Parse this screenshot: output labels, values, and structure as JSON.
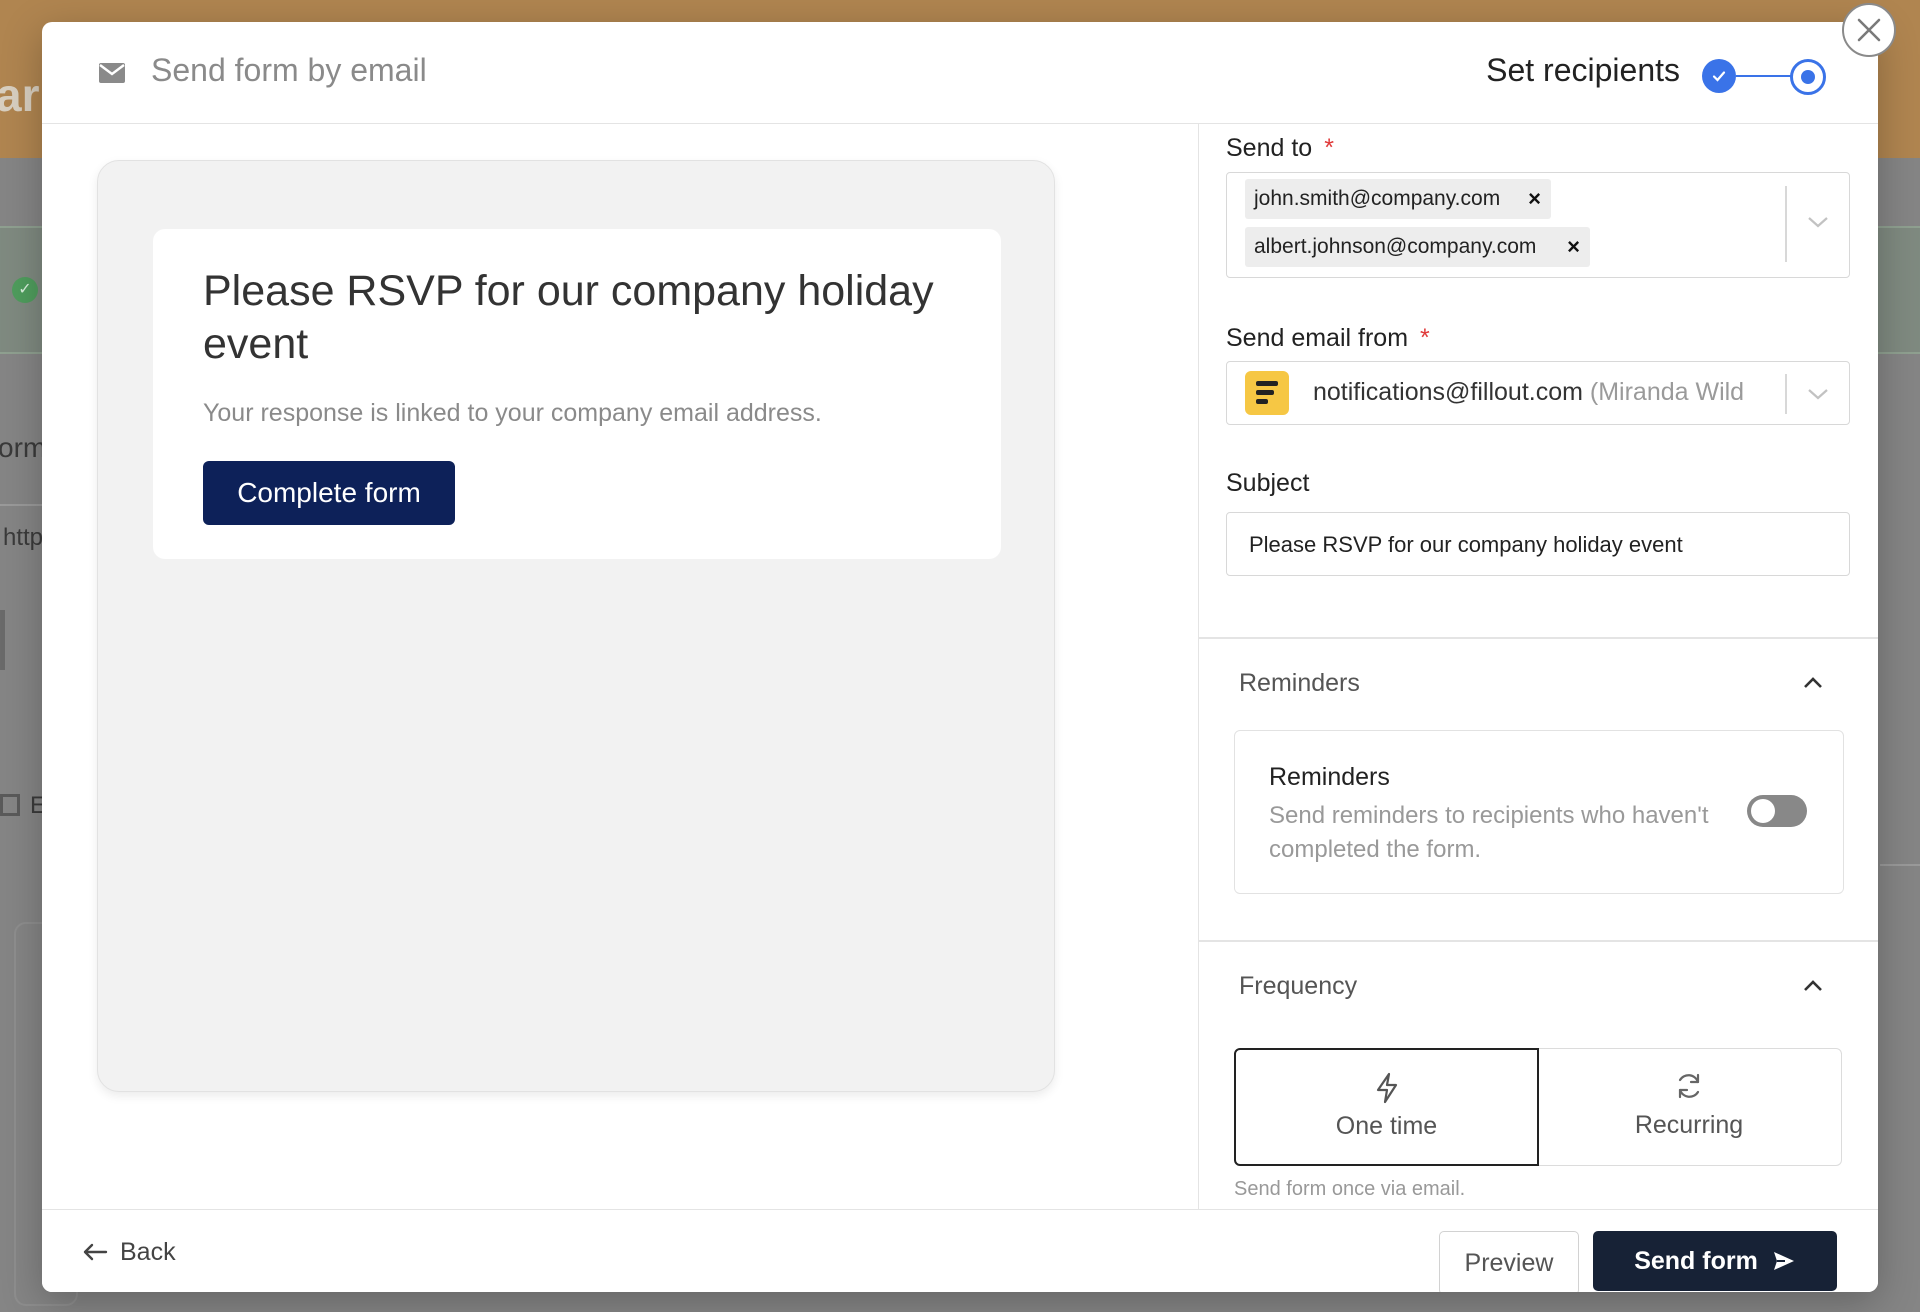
{
  "background": {
    "heading_fragment": "ar",
    "form_fragment": "orm",
    "link_fragment": "http",
    "embed_fragment": "E"
  },
  "header": {
    "title": "Send form by email",
    "step_label": "Set recipients"
  },
  "preview": {
    "title": "Please RSVP for our company holiday event",
    "text": "Your response is linked to your company email address.",
    "button_label": "Complete form"
  },
  "send_to": {
    "label": "Send to",
    "required_mark": "*",
    "chips": [
      {
        "email": "john.smith@company.com",
        "remove": "×"
      },
      {
        "email": "albert.johnson@company.com",
        "remove": "×"
      }
    ]
  },
  "send_from": {
    "label": "Send email from",
    "required_mark": "*",
    "email": "notifications@fillout.com",
    "name": "(Miranda Wild"
  },
  "subject": {
    "label": "Subject",
    "value": "Please RSVP for our company holiday event"
  },
  "reminders": {
    "section_title": "Reminders",
    "box_title": "Reminders",
    "description": "Send reminders to recipients who haven't completed the form.",
    "enabled": false
  },
  "frequency": {
    "section_title": "Frequency",
    "options": [
      {
        "label": "One time",
        "icon": "lightning-icon",
        "selected": true
      },
      {
        "label": "Recurring",
        "icon": "refresh-icon",
        "selected": false
      }
    ],
    "note": "Send form once via email."
  },
  "footer": {
    "back_label": "Back",
    "preview_label": "Preview",
    "send_label": "Send form"
  },
  "colors": {
    "primary_dark": "#172236",
    "preview_button": "#0d2159",
    "accent_blue": "#3a73e8",
    "required_red": "#e03a3a",
    "logo_yellow": "#f6c744"
  }
}
